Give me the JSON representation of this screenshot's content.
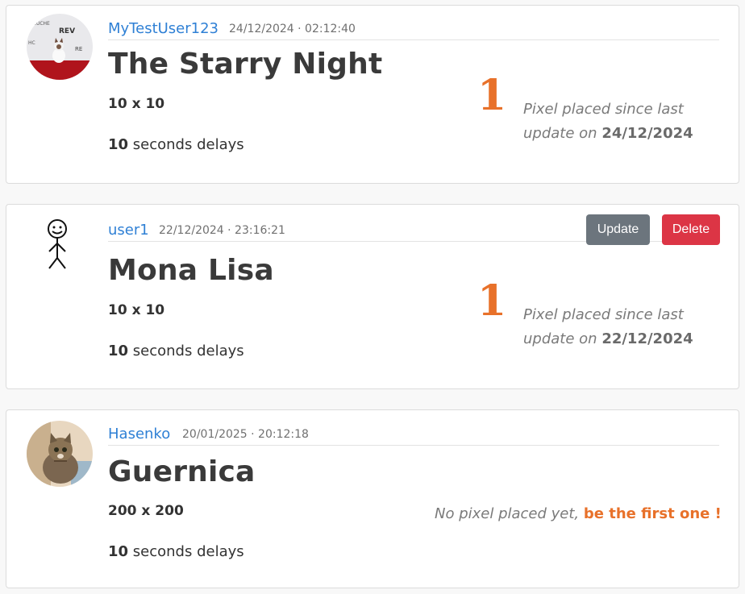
{
  "cards": [
    {
      "username": "MyTestUser123",
      "date": "24/12/2024 · 02:12:40",
      "title": "The Starry Night",
      "size": "10 x 10",
      "delay_value": "10",
      "delay_suffix": " seconds delays",
      "pixel_count": "1",
      "pixel_text": "Pixel placed since last update on",
      "pixel_date": "24/12/2024"
    },
    {
      "username": "user1",
      "date": "22/12/2024 · 23:16:21",
      "title": "Mona Lisa",
      "size": "10 x 10",
      "delay_value": "10",
      "delay_suffix": " seconds delays",
      "pixel_count": "1",
      "pixel_text": "Pixel placed since last update on",
      "pixel_date": "22/12/2024",
      "update_label": "Update",
      "delete_label": "Delete"
    },
    {
      "username": "Hasenko",
      "date": "20/01/2025 · 20:12:18",
      "title": "Guernica",
      "size": "200 x 200",
      "delay_value": "10",
      "delay_suffix": " seconds delays",
      "no_pixel_text": "No pixel placed yet, ",
      "first_link": "be the first one !"
    }
  ],
  "colors": {
    "accent": "#e8712a",
    "link": "#2f80d5",
    "update": "#6c757d",
    "delete": "#dc3545"
  },
  "icons": [
    "cat-photo-avatar",
    "stick-figure-avatar",
    "cat-photo-avatar"
  ]
}
